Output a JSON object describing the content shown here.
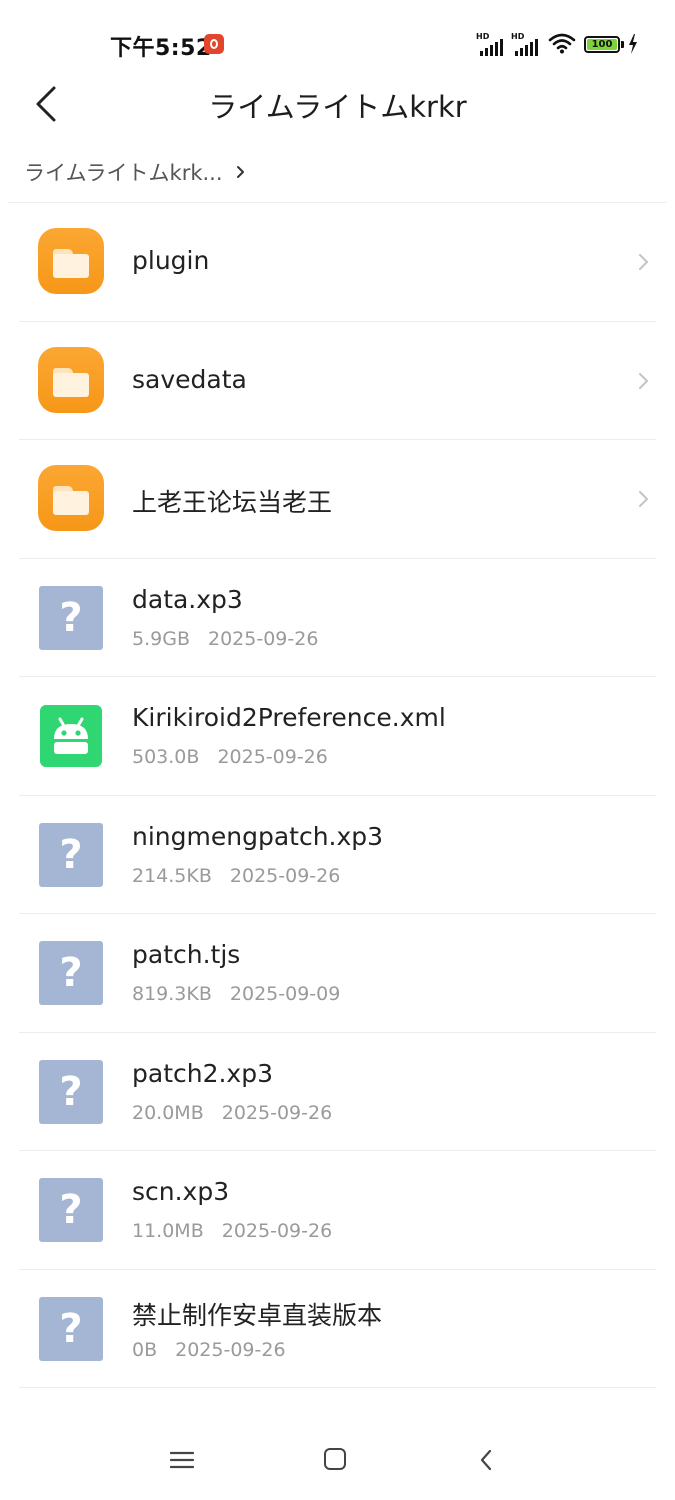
{
  "status_bar": {
    "time": "下午5:52",
    "signal_1_label": "HD",
    "signal_2_label": "HD",
    "battery_level": "100",
    "charging": true
  },
  "header": {
    "title": "ライムライトムkrkr",
    "back_icon": "chevron-left-icon"
  },
  "breadcrumb": {
    "label": "ライムライトムkrk...",
    "icon": "chevron-right-icon"
  },
  "folders": [
    {
      "name": "plugin",
      "icon": "folder-icon"
    },
    {
      "name": "savedata",
      "icon": "folder-icon"
    },
    {
      "name": "上老王论坛当老王",
      "icon": "folder-icon"
    }
  ],
  "files": [
    {
      "name": "data.xp3",
      "size": "5.9GB",
      "date": "2025-09-26",
      "icon": "unknown-file-icon"
    },
    {
      "name": "Kirikiroid2Preference.xml",
      "size": "503.0B",
      "date": "2025-09-26",
      "icon": "android-icon"
    },
    {
      "name": "ningmengpatch.xp3",
      "size": "214.5KB",
      "date": "2025-09-26",
      "icon": "unknown-file-icon"
    },
    {
      "name": "patch.tjs",
      "size": "819.3KB",
      "date": "2025-09-09",
      "icon": "unknown-file-icon"
    },
    {
      "name": "patch2.xp3",
      "size": "20.0MB",
      "date": "2025-09-26",
      "icon": "unknown-file-icon"
    },
    {
      "name": "scn.xp3",
      "size": "11.0MB",
      "date": "2025-09-26",
      "icon": "unknown-file-icon"
    },
    {
      "name": "禁止制作安卓直装版本",
      "size": "0B",
      "date": "2025-09-26",
      "icon": "unknown-file-icon"
    }
  ],
  "unknown_icon_glyph": "?",
  "colors": {
    "folder": "#f69718",
    "unknown_file": "#a5b5d4",
    "android": "#30d672",
    "battery_fill": "#7bd43a"
  },
  "navbar": {
    "menu_icon": "menu-icon",
    "home_icon": "home-icon",
    "back_icon": "back-icon"
  }
}
